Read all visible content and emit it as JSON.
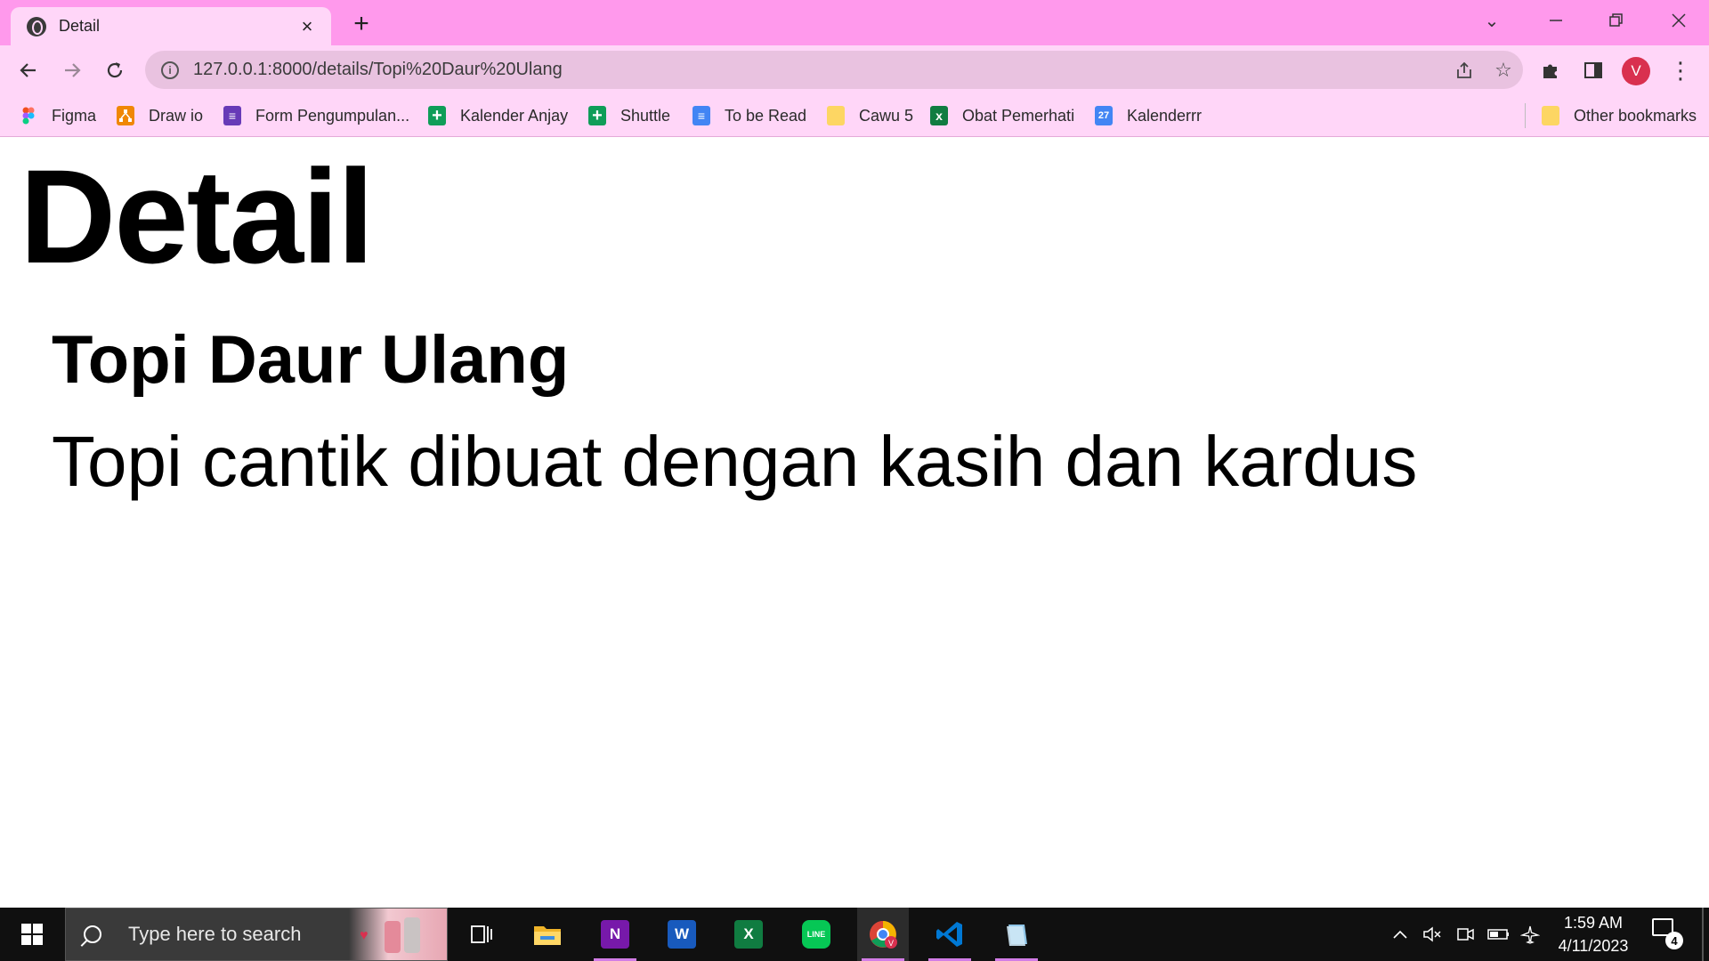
{
  "browser": {
    "tab": {
      "title": "Detail",
      "favicon": "globe-icon",
      "close": "×"
    },
    "new_tab": "+",
    "window_controls": {
      "tab_search": "⌄",
      "minimize": "—",
      "restore": "❐",
      "close": "✕"
    },
    "nav": {
      "back": "←",
      "forward": "→",
      "reload": "↻"
    },
    "address_bar": {
      "url": "127.0.0.1:8000/details/Topi%20Daur%20Ulang",
      "share_icon": "share-icon",
      "star": "☆"
    },
    "toolbar_icons": {
      "extensions": "puzzle-icon",
      "side_panel": "side-panel-icon",
      "menu": "⋮"
    },
    "profile_initial": "V",
    "bookmarks": [
      {
        "label": "Figma",
        "color": "#f24e1e",
        "icon": "figma-icon",
        "glyph": ""
      },
      {
        "label": "Draw io",
        "color": "#f08705",
        "icon": "drawio-icon",
        "glyph": ""
      },
      {
        "label": "Form Pengumpulan...",
        "color": "#673ab7",
        "icon": "forms-icon",
        "glyph": "≡"
      },
      {
        "label": "Kalender Anjay",
        "color": "#0f9d58",
        "icon": "sheets-icon",
        "glyph": "+"
      },
      {
        "label": "Shuttle",
        "color": "#0f9d58",
        "icon": "sheets-icon",
        "glyph": "+"
      },
      {
        "label": "To be Read",
        "color": "#4285f4",
        "icon": "docs-icon",
        "glyph": "≡"
      },
      {
        "label": "Cawu 5",
        "color": "#fdd663",
        "icon": "folder-icon",
        "glyph": ""
      },
      {
        "label": "Obat Pemerhati",
        "color": "#107c41",
        "icon": "excel-icon",
        "glyph": "x"
      },
      {
        "label": "Kalenderrr",
        "color": "#4285f4",
        "icon": "calendar-icon",
        "glyph": "27"
      }
    ],
    "other_bookmarks": "Other bookmarks"
  },
  "page": {
    "heading": "Detail",
    "product_name": "Topi Daur Ulang",
    "product_description": "Topi cantik dibuat dengan kasih dan kardus"
  },
  "taskbar": {
    "search_placeholder": "Type here to search",
    "apps": [
      {
        "name": "task-view-icon",
        "glyph": "⧉",
        "color": "#101010",
        "running": false
      },
      {
        "name": "file-explorer-icon",
        "glyph": "",
        "color": "#f0b429",
        "running": false
      },
      {
        "name": "onenote-icon",
        "glyph": "N",
        "color": "#7719aa",
        "running": true
      },
      {
        "name": "word-icon",
        "glyph": "W",
        "color": "#185abd",
        "running": false
      },
      {
        "name": "excel-icon",
        "glyph": "X",
        "color": "#107c41",
        "running": false
      },
      {
        "name": "line-icon",
        "glyph": "LINE",
        "color": "#06c755",
        "running": false
      },
      {
        "name": "chrome-icon",
        "glyph": "",
        "color": "#db4437",
        "running": true
      },
      {
        "name": "vscode-icon",
        "glyph": "❯",
        "color": "#0078d4",
        "running": true
      },
      {
        "name": "notes-app-icon",
        "glyph": "",
        "color": "#8fc6e8",
        "running": true
      }
    ],
    "tray": {
      "chevron": "^",
      "volume": "🔇",
      "meet": "⌸",
      "battery": "▭",
      "airplane": "✈"
    },
    "clock": {
      "time": "1:59 AM",
      "date": "4/11/2023"
    },
    "notifications_count": "4"
  }
}
